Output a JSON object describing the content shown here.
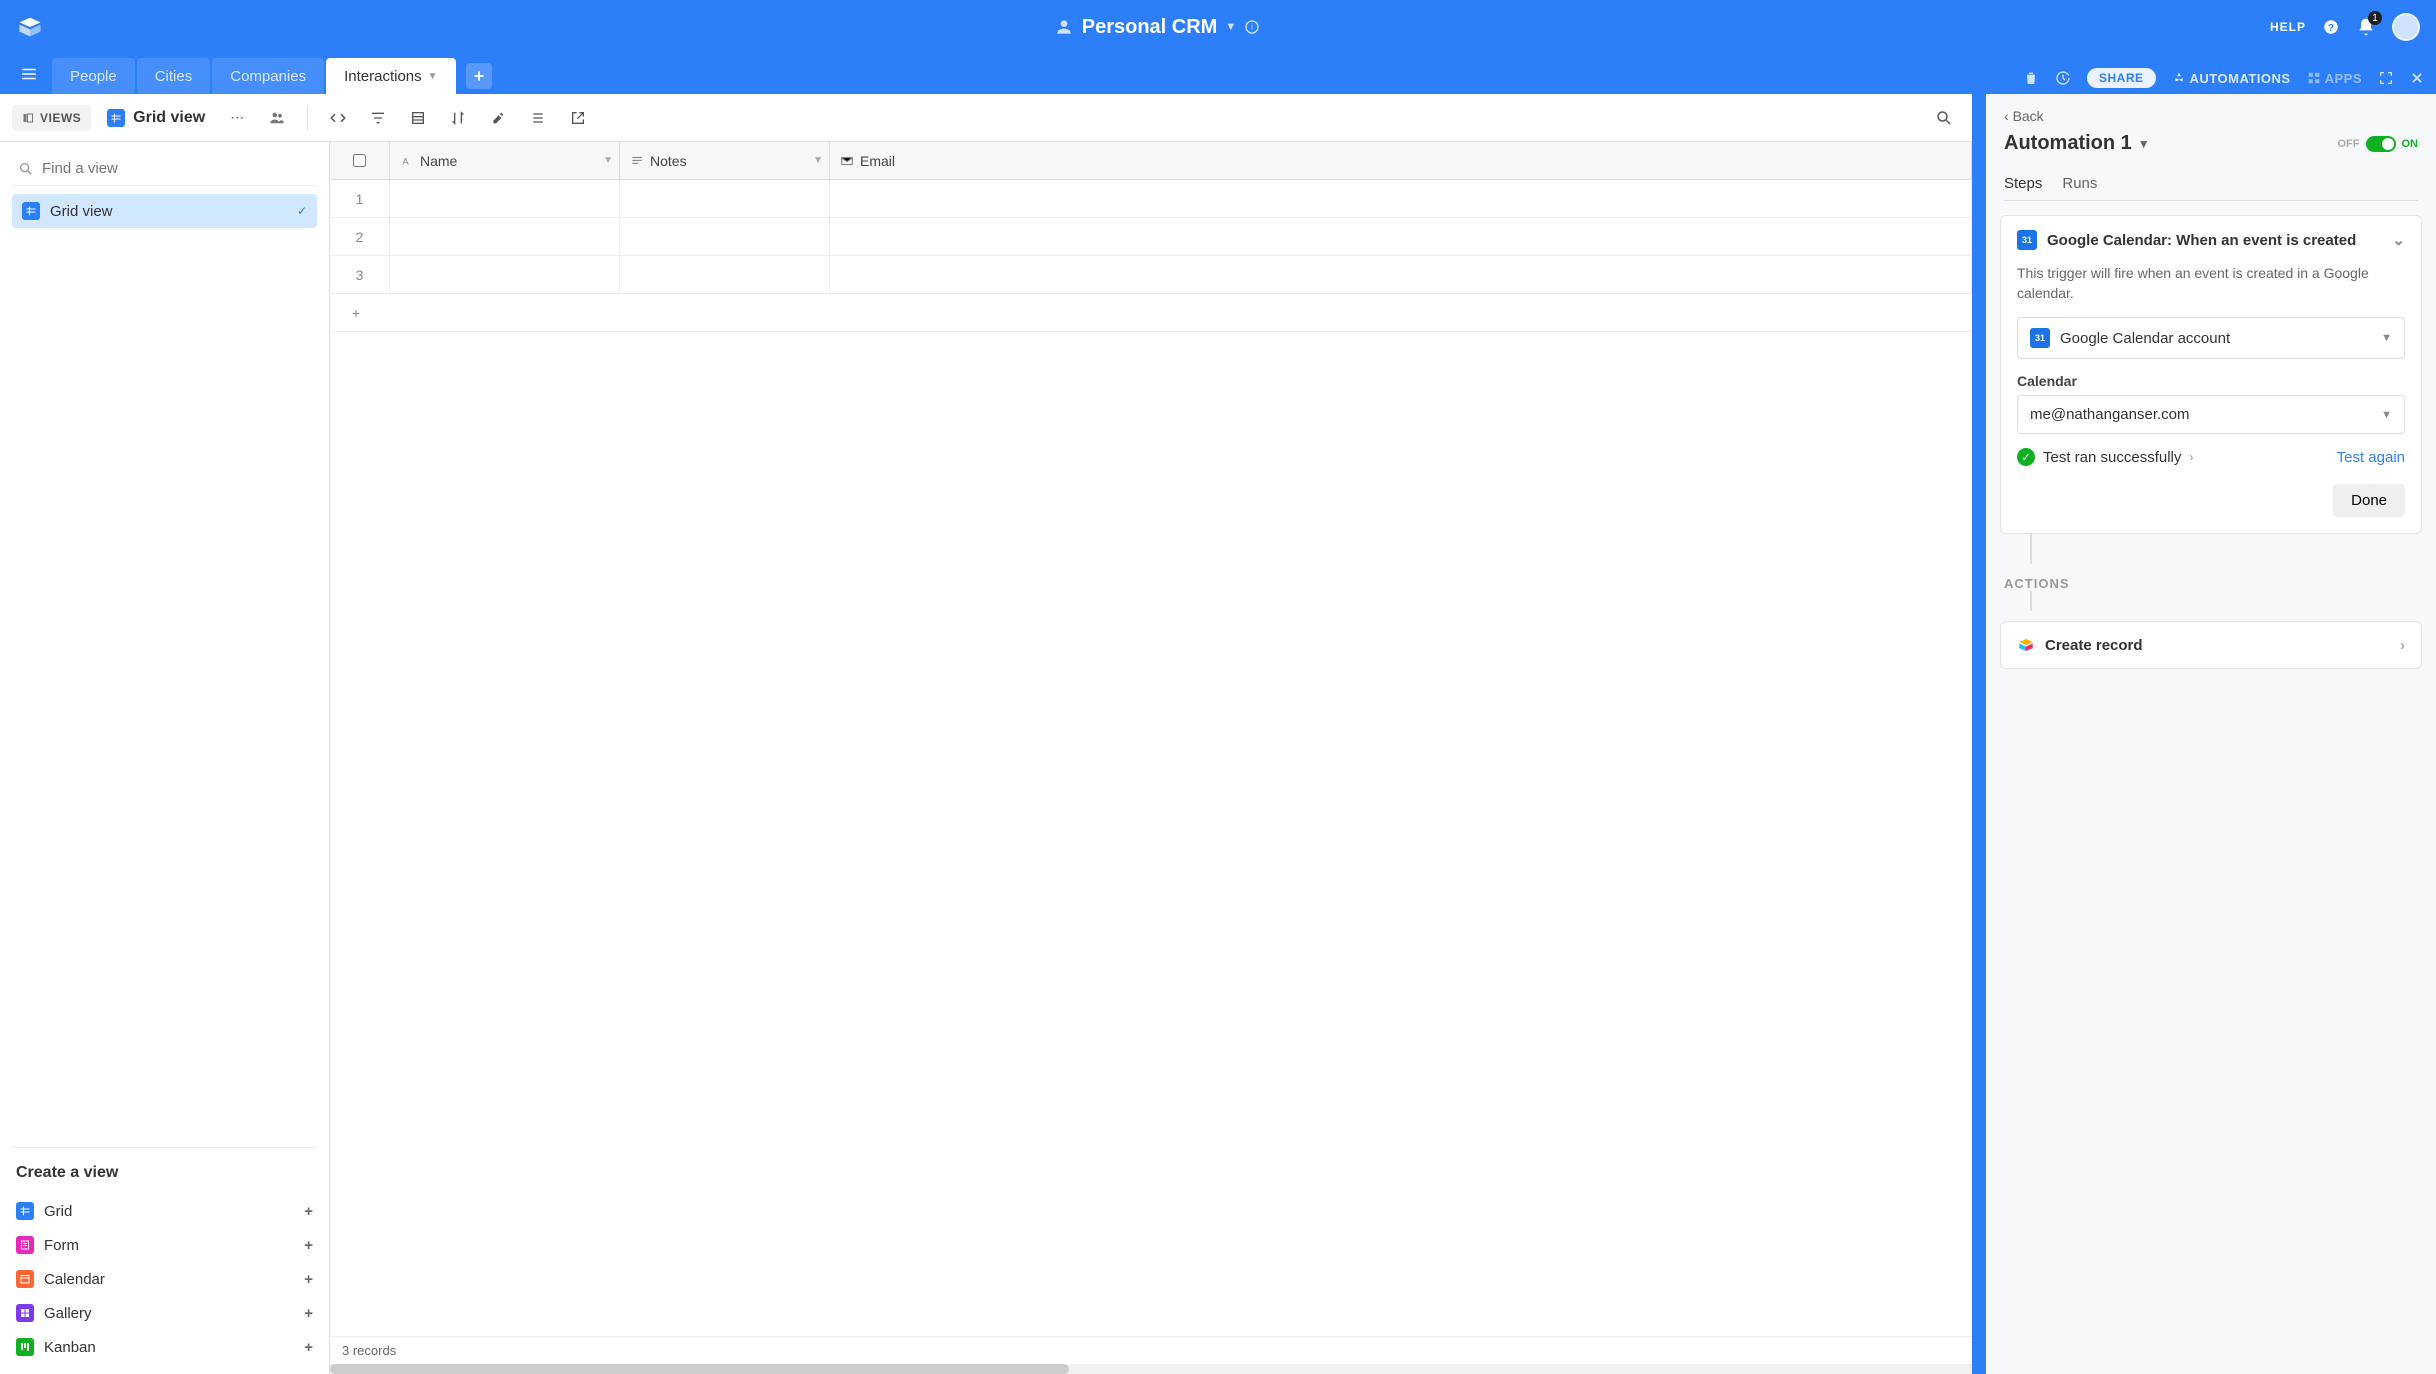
{
  "header": {
    "base_title": "Personal CRM",
    "help_label": "HELP",
    "notification_count": "1"
  },
  "tabs": {
    "items": [
      "People",
      "Cities",
      "Companies",
      "Interactions"
    ],
    "active_index": 3,
    "share_label": "SHARE",
    "automations_label": "AUTOMATIONS",
    "apps_label": "APPS"
  },
  "toolbar": {
    "views_label": "VIEWS",
    "current_view": "Grid view"
  },
  "sidebar": {
    "search_placeholder": "Find a view",
    "views": [
      {
        "label": "Grid view",
        "active": true
      }
    ],
    "create_title": "Create a view",
    "create_options": [
      {
        "label": "Grid",
        "kind": "grid"
      },
      {
        "label": "Form",
        "kind": "form"
      },
      {
        "label": "Calendar",
        "kind": "cal"
      },
      {
        "label": "Gallery",
        "kind": "gal"
      },
      {
        "label": "Kanban",
        "kind": "kan"
      }
    ]
  },
  "grid": {
    "columns": [
      "Name",
      "Notes",
      "Email"
    ],
    "row_numbers": [
      "1",
      "2",
      "3"
    ],
    "footer": "3 records"
  },
  "automation": {
    "back_label": "Back",
    "title": "Automation 1",
    "toggle_off": "OFF",
    "toggle_on": "ON",
    "tabs": [
      "Steps",
      "Runs"
    ],
    "trigger": {
      "title": "Google Calendar: When an event is created",
      "description": "This trigger will fire when an event is created in a Google calendar.",
      "account_label": "Google Calendar account",
      "calendar_label": "Calendar",
      "calendar_value": "me@nathanganser.com",
      "test_result": "Test ran successfully",
      "test_again": "Test again",
      "done_label": "Done"
    },
    "actions_label": "ACTIONS",
    "action_title": "Create record"
  }
}
